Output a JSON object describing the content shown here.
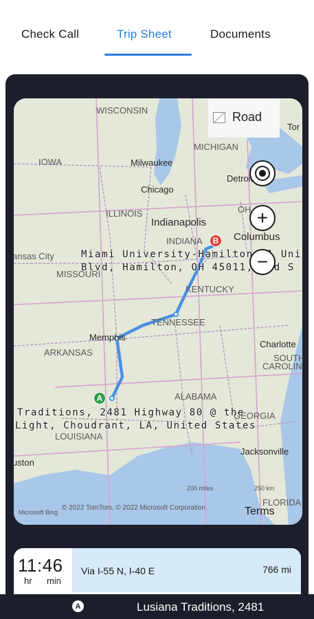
{
  "tabs": [
    {
      "label": "Check Call",
      "active": false
    },
    {
      "label": "Trip Sheet",
      "active": true
    },
    {
      "label": "Documents",
      "active": false
    }
  ],
  "map": {
    "style_button": "Road",
    "state_labels": [
      "WISCONSIN",
      "MICHIGAN",
      "IOWA",
      "ILLINOIS",
      "INDIANA",
      "OH",
      "MISSOURI",
      "KENTUCKY",
      "TENNESSEE",
      "ARKANSAS",
      "ALABAMA",
      "GEORGIA",
      "LOUISIANA",
      "FLORIDA",
      "SOUTH",
      "CAROLIN",
      "ansas City"
    ],
    "city_labels": [
      "Milwaukee",
      "Chicago",
      "Indianapolis",
      "Columbus",
      "Detroit",
      "Memphis",
      "Charlotte",
      "Jacksonville",
      "uston",
      "Tor"
    ],
    "pin_a": {
      "letter": "A",
      "color": "#2e9e44",
      "label_lines": [
        "Traditions, 2481 Highway 80 @ the",
        "Light, Choudrant, LA, United States"
      ]
    },
    "pin_b": {
      "letter": "B",
      "color": "#e53935",
      "label_lines": [
        "Miami University-Hamilton, 1 Uni",
        "Blvd, Hamilton, OH 45011, ted S"
      ]
    },
    "scale_miles": "200 miles",
    "scale_km": "250 km",
    "attribution": "© 2022 TomTom, © 2022 Microsoft Corporation",
    "bing_logo": "Microsoft Bing",
    "terms": "Terms",
    "route_color": "#4a90e2"
  },
  "trip": {
    "time_value": "11:46",
    "hours_label": "hr",
    "minutes_label": "min",
    "via": "Via I-55 N, I-40 E",
    "distance": "766 mi"
  },
  "stop": {
    "marker": "A",
    "address": "Lusiana Traditions, 2481"
  }
}
